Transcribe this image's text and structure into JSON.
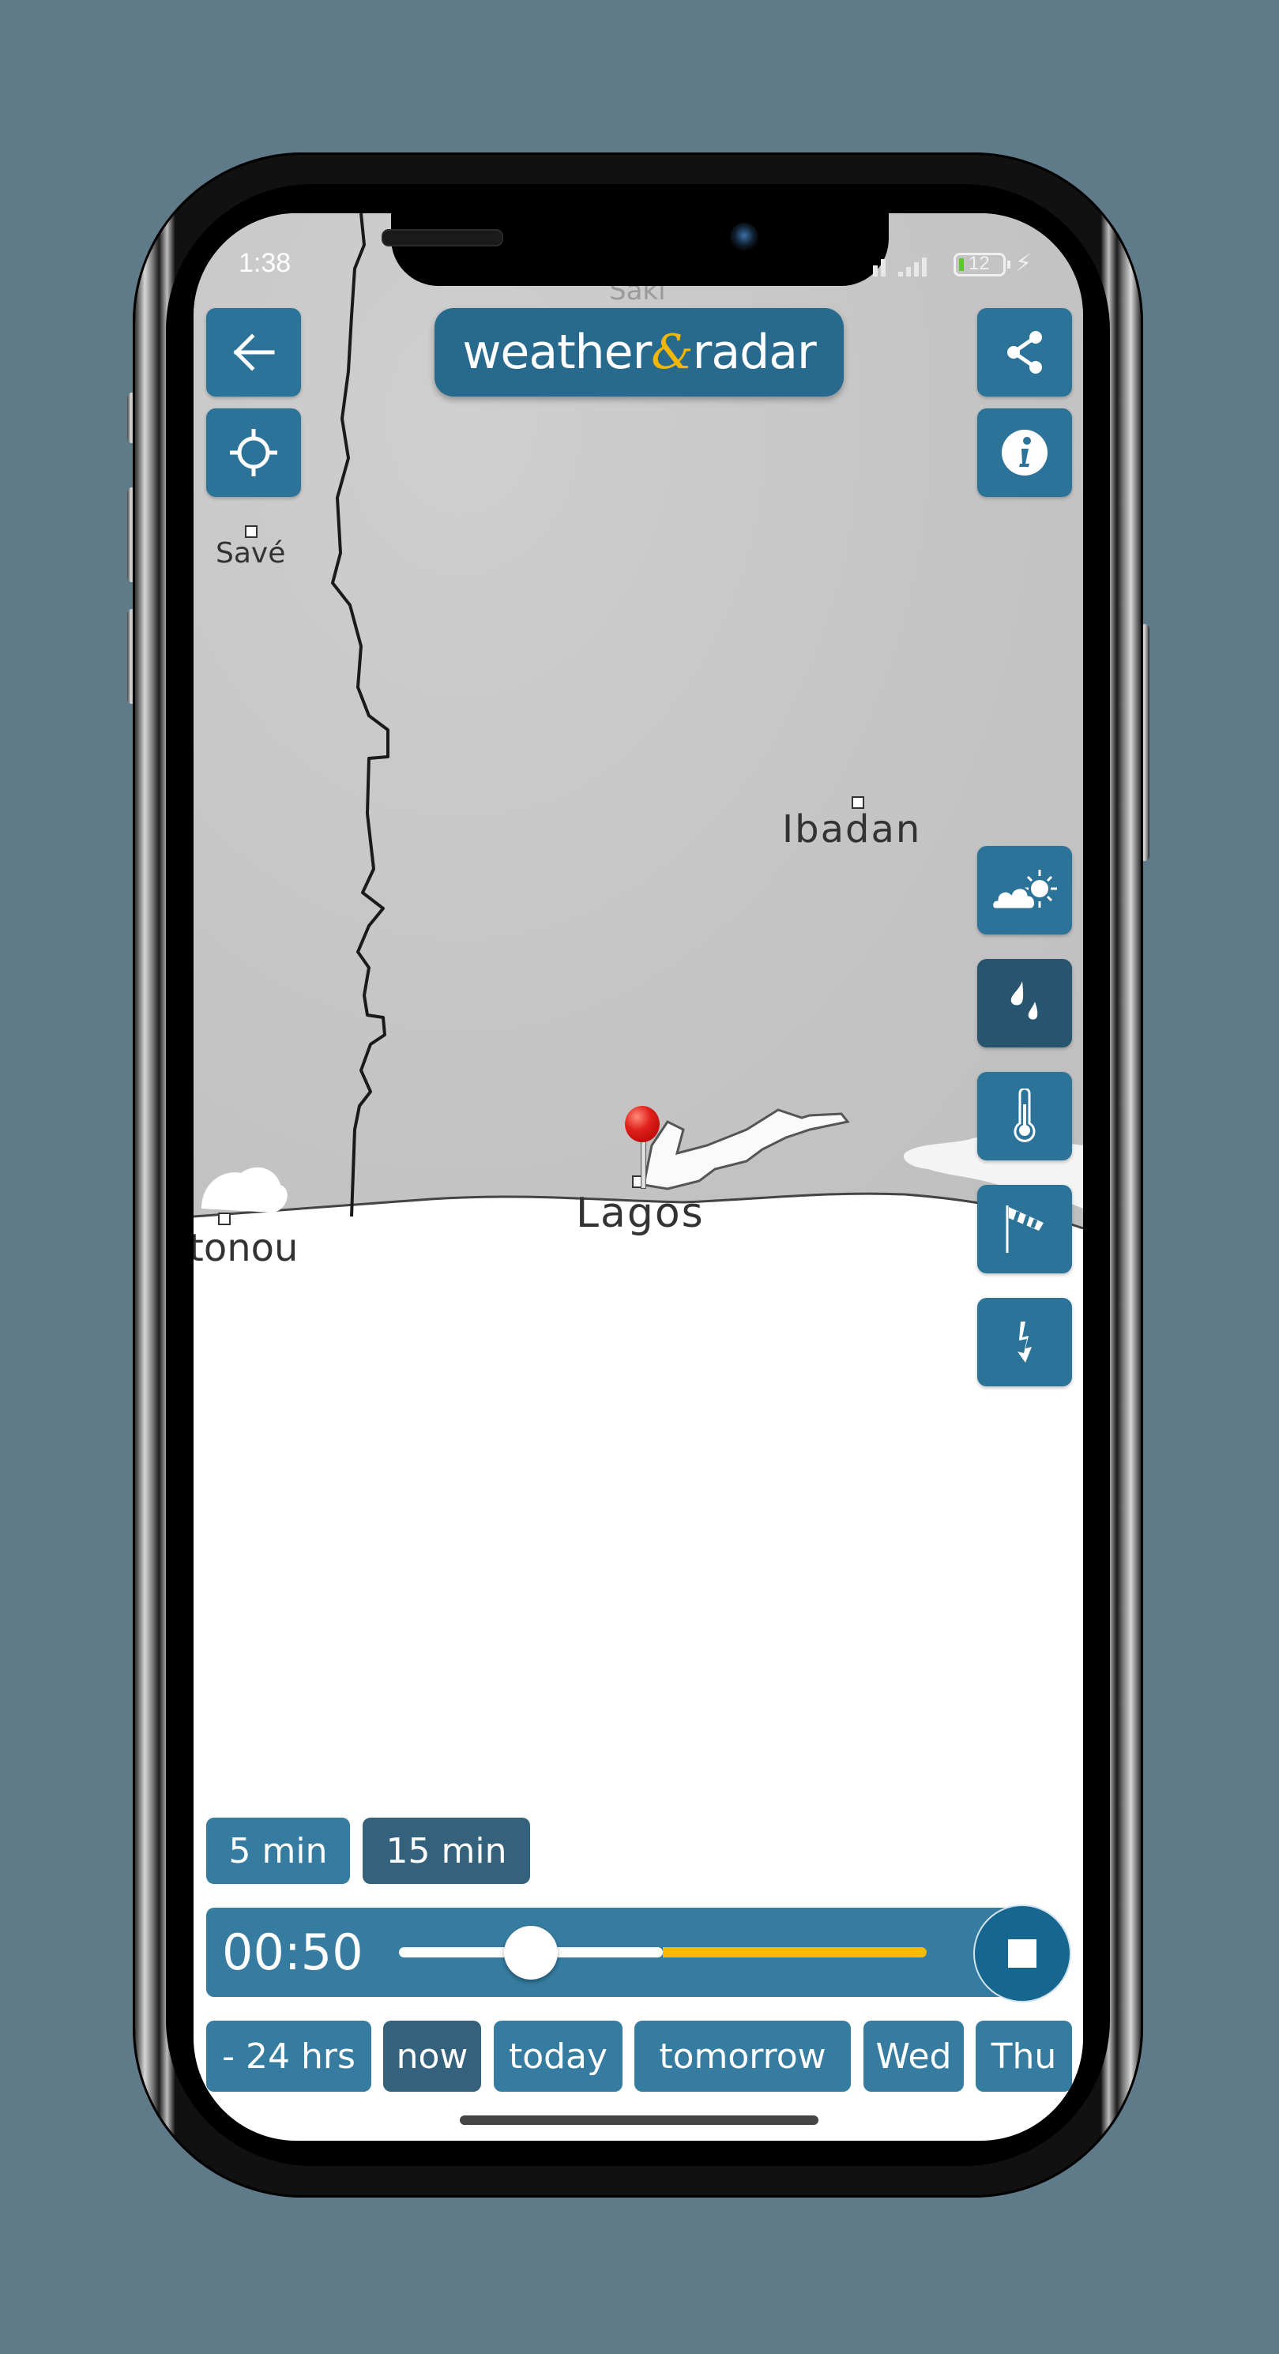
{
  "status_bar": {
    "time": "1:38",
    "battery_level": "12",
    "battery_charging": true
  },
  "header": {
    "logo_text_left": "weather",
    "logo_amp": "&",
    "logo_text_right": "radar",
    "back_icon": "arrow-left-icon",
    "locate_icon": "crosshair-icon",
    "share_icon": "share-icon",
    "info_icon": "info-icon"
  },
  "map": {
    "labels": [
      {
        "name": "Saki"
      },
      {
        "name": "Savé"
      },
      {
        "name": "Ibadan"
      },
      {
        "name": "Lagos"
      },
      {
        "name": "tonou"
      }
    ],
    "pin_color": "#e0201b"
  },
  "layers": [
    {
      "id": "forecast",
      "icon": "cloud-sun-icon",
      "active": false
    },
    {
      "id": "rain",
      "icon": "raindrops-icon",
      "active": true
    },
    {
      "id": "temperature",
      "icon": "thermometer-icon",
      "active": false
    },
    {
      "id": "wind",
      "icon": "windsock-icon",
      "active": false
    },
    {
      "id": "lightning",
      "icon": "lightning-icon",
      "active": false
    }
  ],
  "interval": {
    "options": [
      "5 min",
      "15 min"
    ],
    "selected": "15 min"
  },
  "player": {
    "time": "00:50",
    "slider_position": 0.25,
    "past_fraction": 0.5,
    "state": "playing",
    "stop_icon": "stop-icon"
  },
  "range_tabs": {
    "options": [
      "- 24 hrs",
      "now",
      "today",
      "tomorrow",
      "Wed",
      "Thu"
    ],
    "selected": "now"
  },
  "colors": {
    "background": "#5f7b8a",
    "button_blue": "#2c7399",
    "button_active": "#27546e",
    "accent_yellow": "#f5bb00"
  }
}
